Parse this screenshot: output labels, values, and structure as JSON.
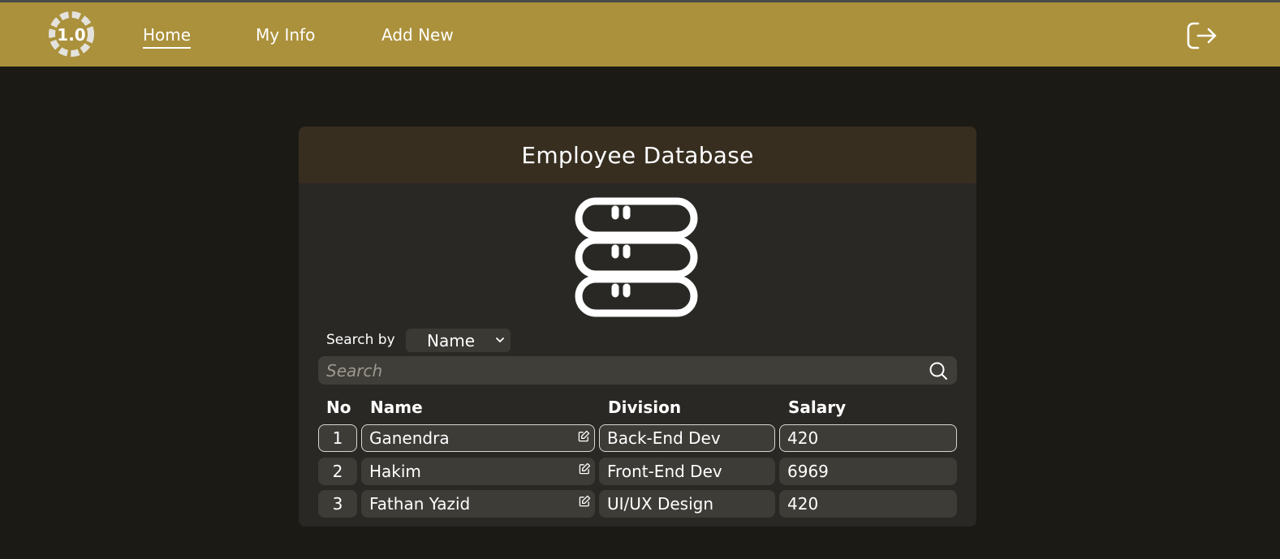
{
  "nav": {
    "logo_text": "1.0",
    "links": [
      {
        "label": "Home",
        "active": true
      },
      {
        "label": "My Info",
        "active": false
      },
      {
        "label": "Add New",
        "active": false
      }
    ],
    "logout_icon": "logout-icon"
  },
  "card": {
    "title": "Employee Database",
    "icon": "database-icon"
  },
  "search": {
    "by_label": "Search by",
    "field": "Name",
    "placeholder": "Search",
    "value": ""
  },
  "table": {
    "columns": [
      "No",
      "Name",
      "Division",
      "Salary"
    ],
    "rows": [
      {
        "no": "1",
        "name": "Ganendra",
        "division": "Back-End Dev",
        "salary": "420"
      },
      {
        "no": "2",
        "name": "Hakim",
        "division": "Front-End Dev",
        "salary": "6969"
      },
      {
        "no": "3",
        "name": "Fathan Yazid",
        "division": "UI/UX Design",
        "salary": "420"
      }
    ]
  },
  "colors": {
    "navbar": "#ab913c",
    "background": "#1c1a15",
    "card": "#292824",
    "card_header": "#372e20",
    "cell": "#3e3c37"
  }
}
